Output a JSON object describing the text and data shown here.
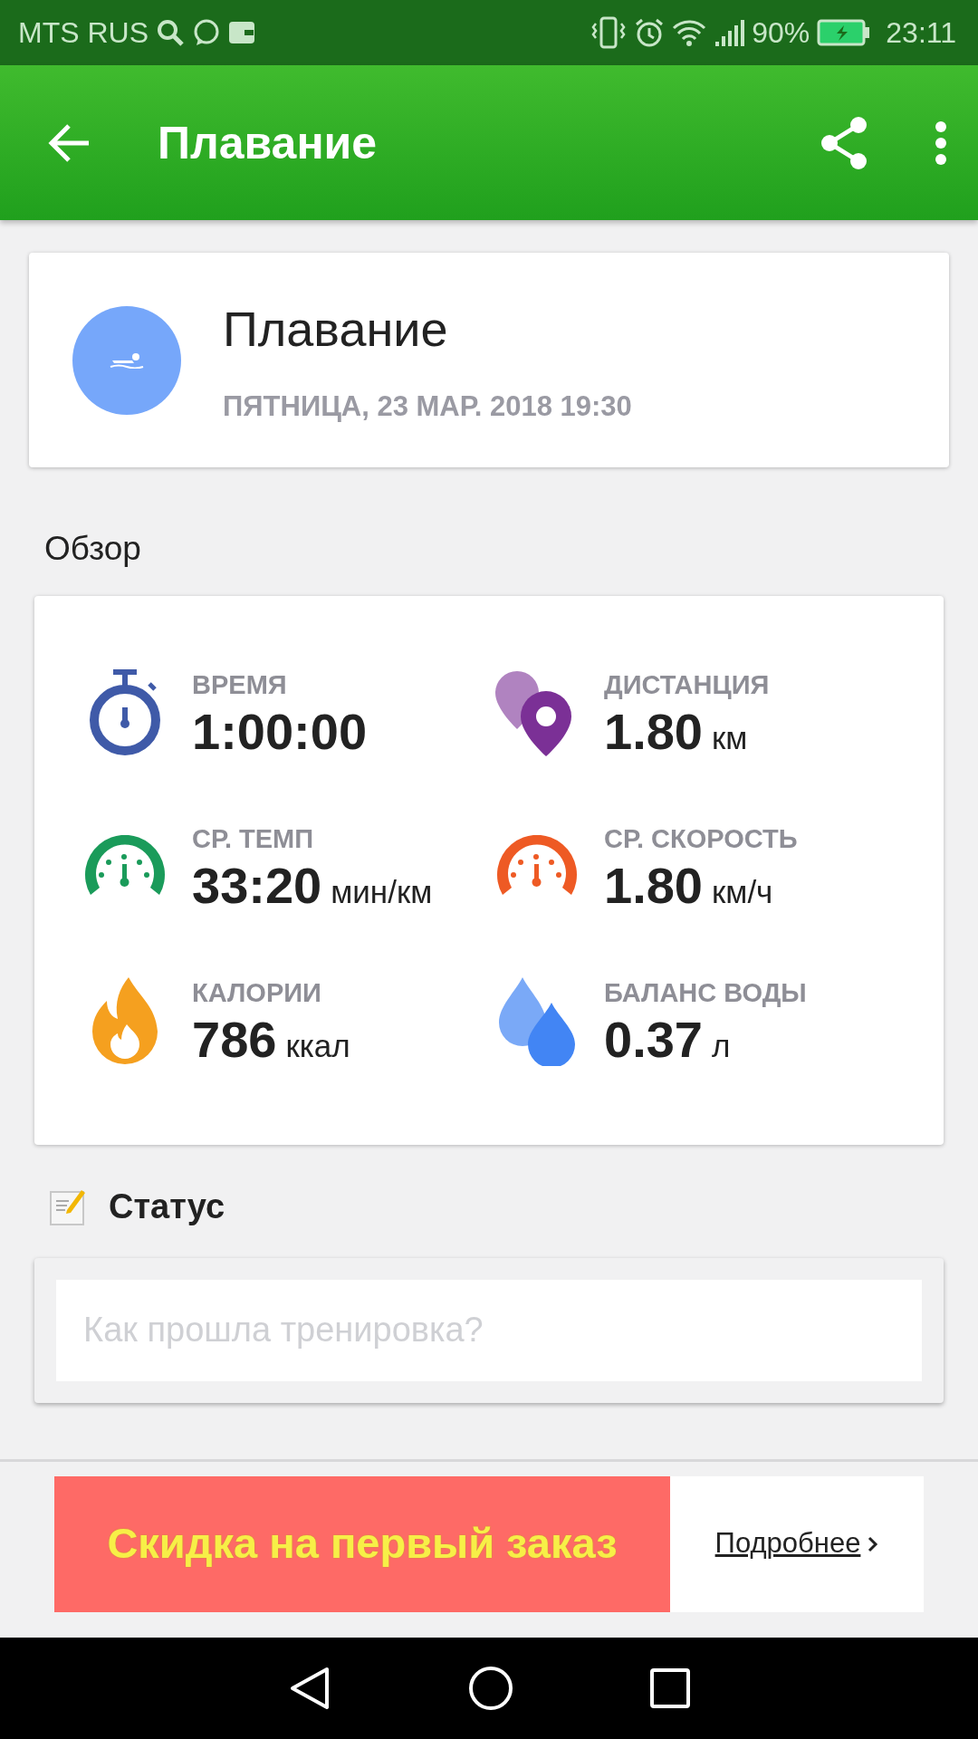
{
  "status_bar": {
    "carrier": "MTS RUS",
    "battery": "90%",
    "time": "23:11"
  },
  "app_bar": {
    "title": "Плавание"
  },
  "activity": {
    "title": "Плавание",
    "date": "ПЯТНИЦА, 23 МАР. 2018 19:30"
  },
  "overview": {
    "heading": "Обзор",
    "metrics": [
      {
        "kind": "stopwatch",
        "color": "#3f5aa8",
        "label": "ВРЕМЯ",
        "value": "1:00:00"
      },
      {
        "kind": "pins",
        "color": "#7b3096",
        "label": "ДИСТАНЦИЯ",
        "value": "1.80",
        "unit": "км"
      },
      {
        "kind": "gauge",
        "color": "#1a9b5a",
        "label": "СР. ТЕМП",
        "value": "33:20",
        "unit": "мин/км"
      },
      {
        "kind": "gauge",
        "color": "#ee5a24",
        "label": "СР. СКОРОСТЬ",
        "value": "1.80",
        "unit": "км/ч"
      },
      {
        "kind": "flame",
        "color": "#f5a01f",
        "label": "КАЛОРИИ",
        "value": "786",
        "unit": "ккал"
      },
      {
        "kind": "drops",
        "color": "#4285f4",
        "label": "БАЛАНС ВОДЫ",
        "value": "0.37",
        "unit": "л"
      }
    ]
  },
  "status": {
    "heading": "Статус",
    "placeholder": "Как прошла тренировка?"
  },
  "ad": {
    "text": "Скидка на первый заказ",
    "link": "Подробнее"
  }
}
